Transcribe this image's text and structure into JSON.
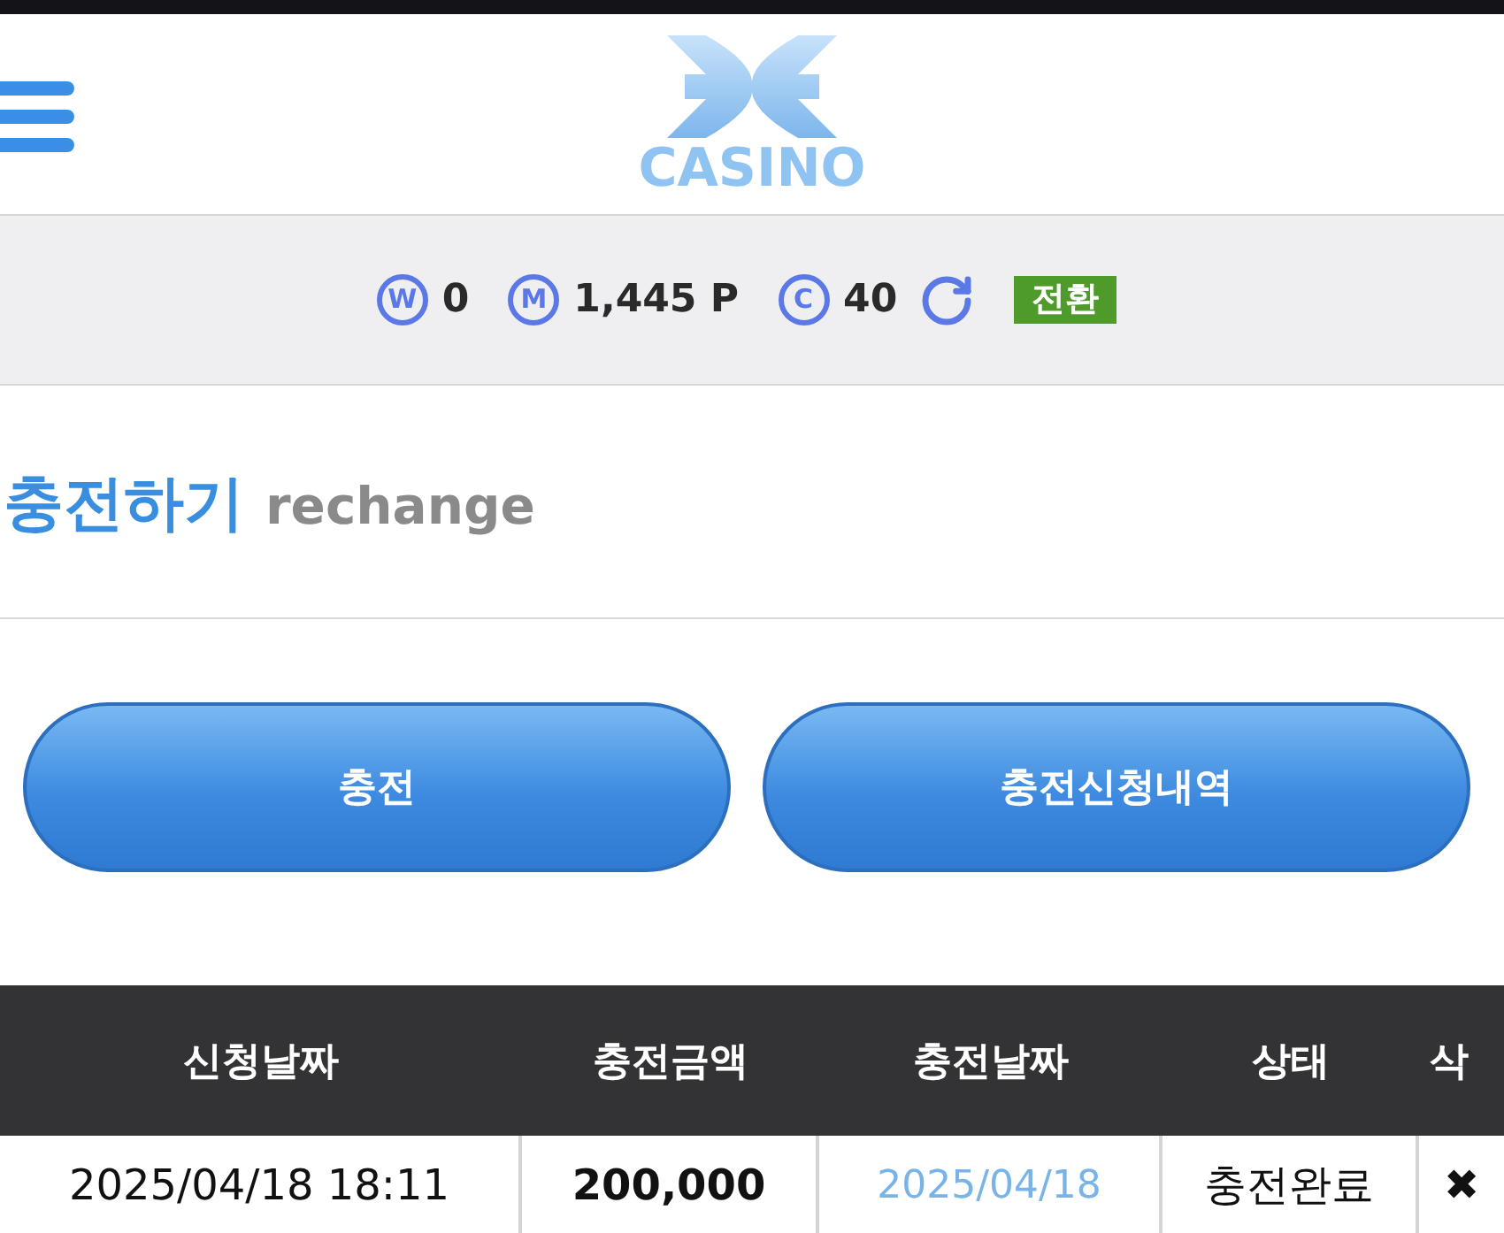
{
  "header": {
    "logo_text": "CASINO"
  },
  "balances": [
    {
      "symbol": "W",
      "amount": "0"
    },
    {
      "symbol": "M",
      "amount": "1,445 P"
    },
    {
      "symbol": "C",
      "amount": "40"
    }
  ],
  "convert_button": {
    "label": "전환"
  },
  "page_title": {
    "title": "충전하기",
    "subtitle": "rechange"
  },
  "buttons": [
    {
      "label": "충전"
    },
    {
      "label": "충전신청내역"
    }
  ],
  "table": {
    "columns": [
      "신청날짜",
      "충전금액",
      "충전날짜",
      "상태",
      "삭"
    ],
    "rows": [
      {
        "request_date": "2025/04/18 18:11",
        "amount": "200,000",
        "charge_date": "2025/04/18",
        "status": "충전완료",
        "delete": "✖"
      }
    ]
  }
}
